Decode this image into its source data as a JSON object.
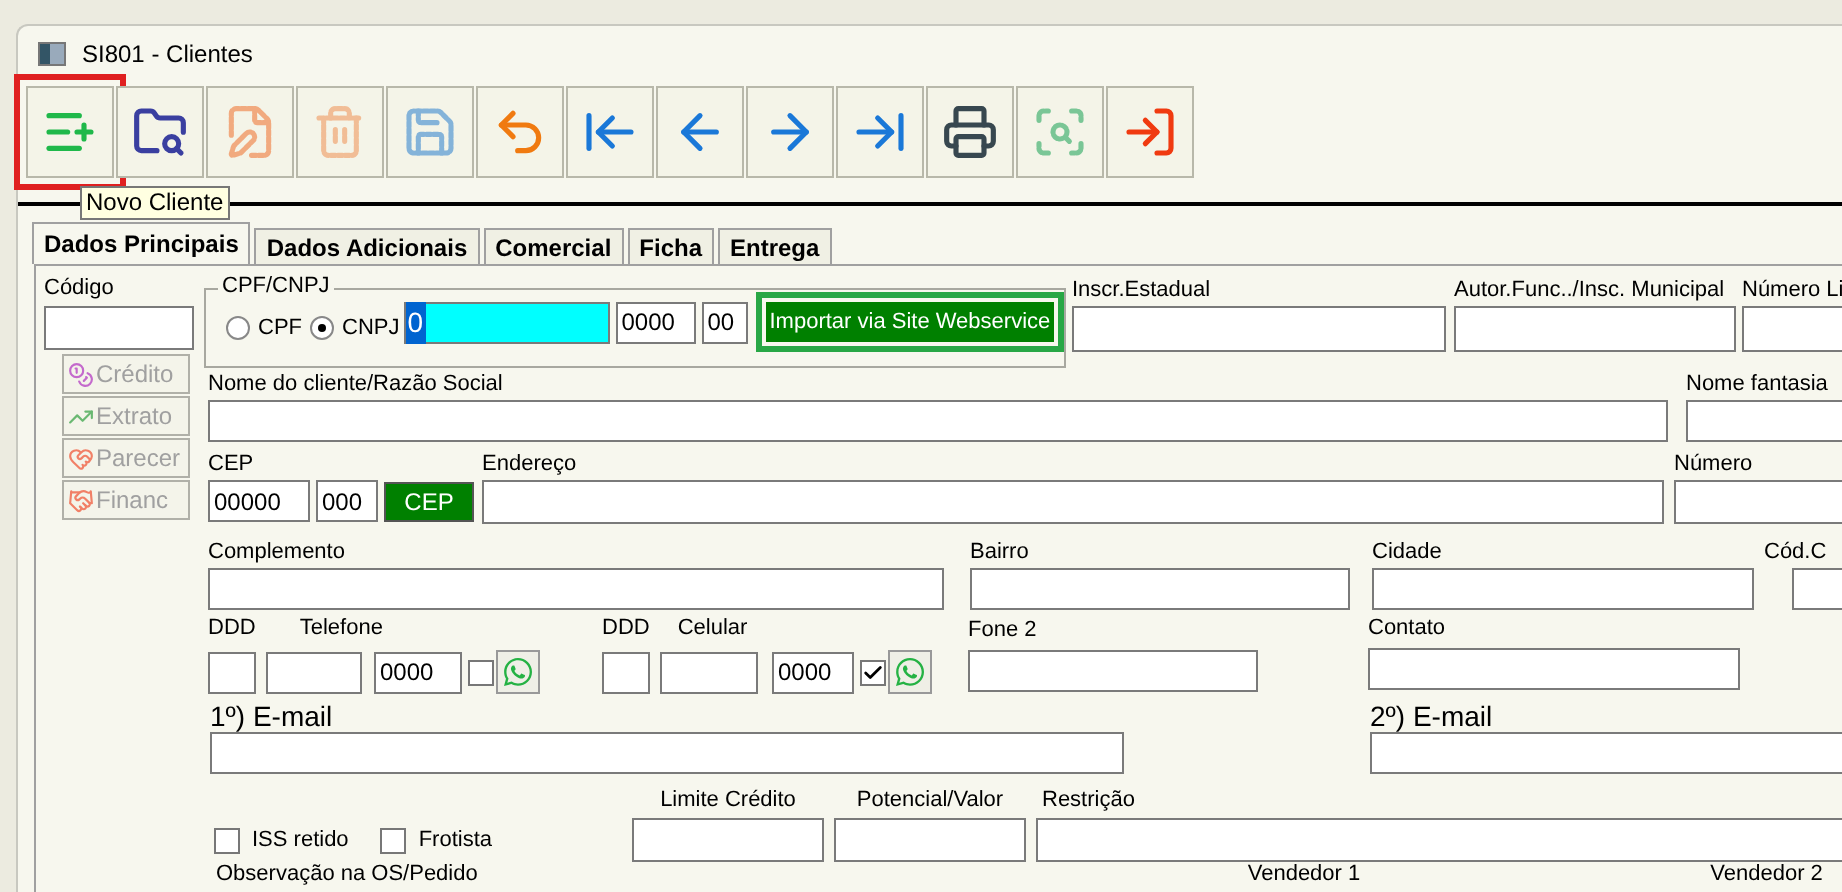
{
  "window": {
    "title": "SI801 - Clientes"
  },
  "toolbar": [
    {
      "kind": "new",
      "disabled": false,
      "highlighted": true
    },
    {
      "kind": "search",
      "disabled": false,
      "highlighted": false
    },
    {
      "kind": "edit",
      "disabled": true,
      "highlighted": false
    },
    {
      "kind": "delete",
      "disabled": true,
      "highlighted": false
    },
    {
      "kind": "save",
      "disabled": true,
      "highlighted": false
    },
    {
      "kind": "undo",
      "disabled": false,
      "highlighted": false
    },
    {
      "kind": "first",
      "disabled": false,
      "highlighted": false
    },
    {
      "kind": "prev",
      "disabled": false,
      "highlighted": false
    },
    {
      "kind": "next",
      "disabled": false,
      "highlighted": false
    },
    {
      "kind": "last",
      "disabled": false,
      "highlighted": false
    },
    {
      "kind": "print",
      "disabled": false,
      "highlighted": false
    },
    {
      "kind": "find",
      "disabled": true,
      "highlighted": false
    },
    {
      "kind": "exit",
      "disabled": false,
      "highlighted": false
    }
  ],
  "tooltip": "Novo Cliente",
  "tabs": [
    {
      "label": "Dados Principais",
      "selected": true
    },
    {
      "label": "Dados Adicionais",
      "selected": false
    },
    {
      "label": "Comercial",
      "selected": false
    },
    {
      "label": "Ficha",
      "selected": false
    },
    {
      "label": "Entrega",
      "selected": false
    }
  ],
  "codigo_label": "Código",
  "side_buttons": [
    {
      "kind": "credit",
      "label": "Crédito",
      "disabled": true
    },
    {
      "kind": "statement",
      "label": "Extrato",
      "disabled": true
    },
    {
      "kind": "opinion",
      "label": "Parecer",
      "disabled": true
    },
    {
      "kind": "finance",
      "label": "Financ",
      "disabled": true
    }
  ],
  "cpf_cnpj": {
    "label": "CPF/CNPJ",
    "options": [
      {
        "label": "CPF",
        "selected": false
      },
      {
        "label": "CNPJ",
        "selected": true
      }
    ],
    "parts": [
      "0",
      "0000",
      "00"
    ]
  },
  "import_button": {
    "label": "Importar via Site Webservice",
    "highlighted": true
  },
  "labels": {
    "inscr_estadual": "Inscr.Estadual",
    "autor_func": "Autor.Func../Insc. Municipal",
    "numero_lic": "Número Li",
    "nome": "Nome do cliente/Razão Social",
    "nome_fantasia": "Nome fantasia",
    "cep": "CEP",
    "endereco": "Endereço",
    "numero": "Número",
    "complemento": "Complemento",
    "bairro": "Bairro",
    "cidade": "Cidade",
    "cod": "Cód.C",
    "ddd": "DDD",
    "telefone": "Telefone",
    "ddd2": "DDD",
    "celular": "Celular",
    "fone2": "Fone 2",
    "contato": "Contato",
    "email1": "1º) E-mail",
    "email2": "2º) E-mail",
    "limite": "Limite Crédito",
    "potencial": "Potencial/Valor",
    "restricao": "Restrição",
    "observacao": "Observação na OS/Pedido",
    "vendedor1": "Vendedor 1",
    "vendedor2": "Vendedor 2"
  },
  "cep": {
    "parts": [
      "00000",
      "000"
    ],
    "button": "CEP"
  },
  "telefone": {
    "suffix": "0000",
    "checked": false
  },
  "celular": {
    "suffix": "0000",
    "checked": true
  },
  "options": [
    {
      "label": "ISS retido",
      "checked": false
    },
    {
      "label": "Frotista",
      "checked": false
    }
  ]
}
